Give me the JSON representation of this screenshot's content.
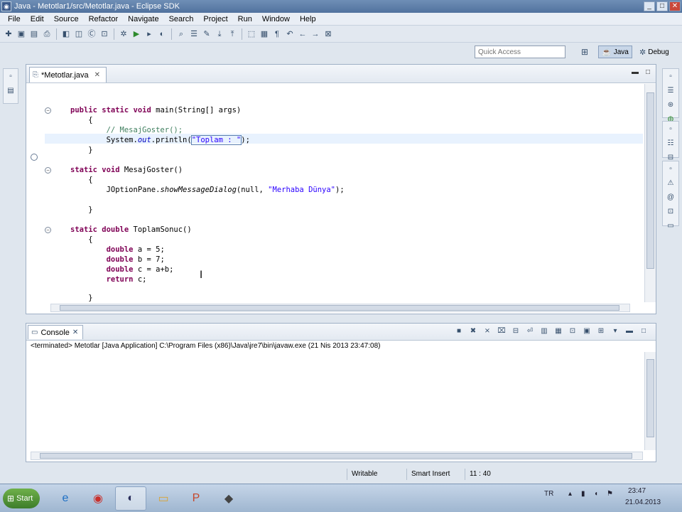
{
  "window": {
    "title": "Java - Metotlar1/src/Metotlar.java - Eclipse SDK",
    "controls": {
      "minimize": "_",
      "maximize": "□",
      "close": "✕"
    }
  },
  "menu": [
    "File",
    "Edit",
    "Source",
    "Refactor",
    "Navigate",
    "Search",
    "Project",
    "Run",
    "Window",
    "Help"
  ],
  "quick_access": {
    "placeholder": "Quick Access"
  },
  "perspectives": {
    "java": "Java",
    "debug": "Debug"
  },
  "editor": {
    "tab_label": "*Metotlar.java"
  },
  "code_lines": [
    {
      "kind": "main_sig"
    },
    {
      "text": "    {"
    },
    {
      "kind": "comment",
      "text": "        // MesajGoster();"
    },
    {
      "kind": "println"
    },
    {
      "text": "    }"
    },
    {
      "text": ""
    },
    {
      "kind": "mesaj_sig"
    },
    {
      "text": "    {"
    },
    {
      "kind": "joption"
    },
    {
      "text": ""
    },
    {
      "text": "    }"
    },
    {
      "text": ""
    },
    {
      "kind": "toplam_sig"
    },
    {
      "text": "    {"
    },
    {
      "kind": "decl",
      "var": "a = 5;"
    },
    {
      "kind": "decl",
      "var": "b = 7;"
    },
    {
      "kind": "decl",
      "var": "c = a+b;"
    },
    {
      "kind": "return",
      "text": " c;"
    },
    {
      "text": ""
    },
    {
      "text": "    }"
    }
  ],
  "code": {
    "kw_public": "public",
    "kw_static": "static",
    "kw_void": "void",
    "kw_double": "double",
    "kw_return": "return",
    "main_rest": " main(String[] args)",
    "mesaj_rest": " MesajGoster()",
    "toplam_rest": " ToplamSonuc()",
    "println_pre": "        System.",
    "println_field": "out",
    "println_mid": ".println(",
    "println_str": "\"Toplam : \"",
    "println_end": ");",
    "joption_pre": "        JOptionPane.",
    "joption_method": "showMessageDialog",
    "joption_mid": "(null, ",
    "joption_str": "\"Merhaba Dünya\"",
    "joption_end": ");"
  },
  "console": {
    "tab_label": "Console",
    "status": "<terminated> Metotlar [Java Application] C:\\Program Files (x86)\\Java\\jre7\\bin\\javaw.exe (21 Nis 2013 23:47:08)"
  },
  "statusbar": {
    "writable": "Writable",
    "insert_mode": "Smart Insert",
    "position": "11 : 40"
  },
  "taskbar": {
    "start_label": "Start",
    "language": "TR",
    "time": "23:47",
    "date": "21.04.2013"
  }
}
